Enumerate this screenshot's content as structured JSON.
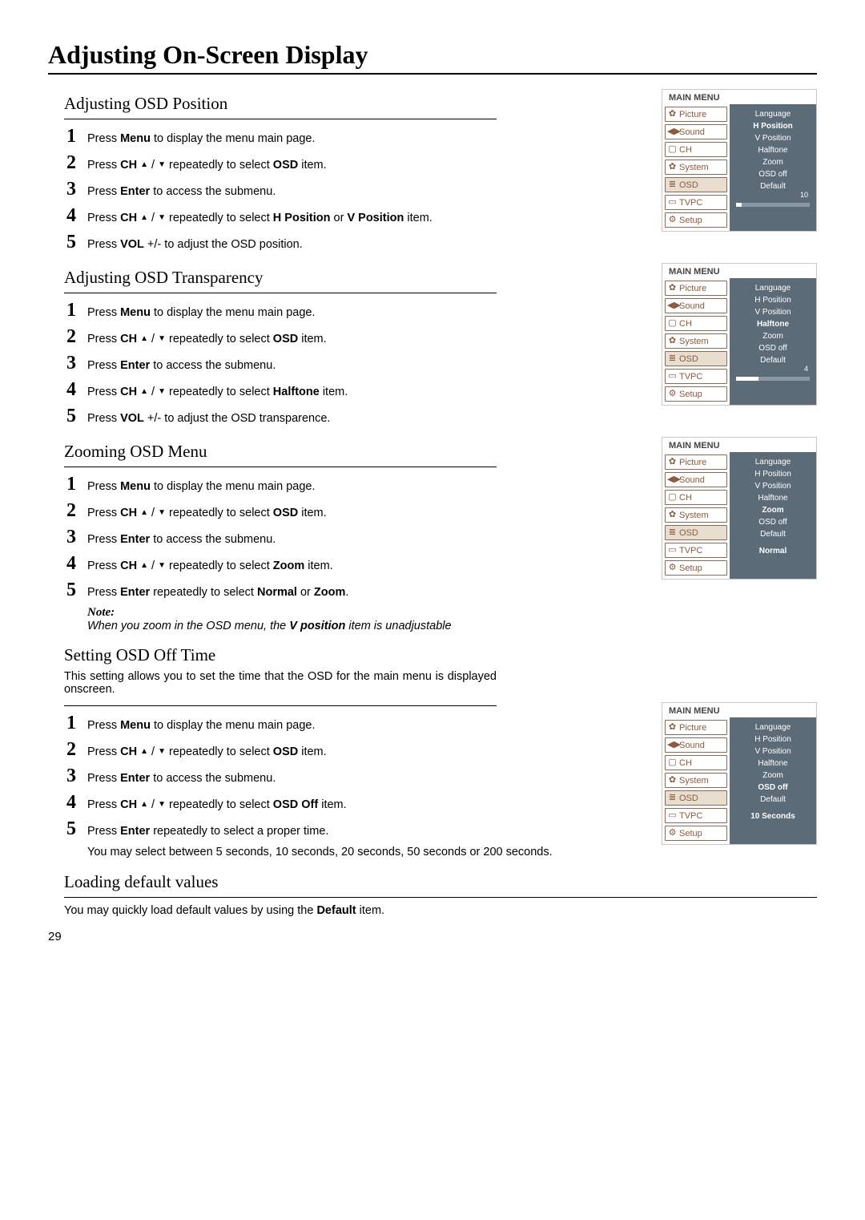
{
  "page": {
    "title": "Adjusting On-Screen Display",
    "number": "29"
  },
  "sections": {
    "position": {
      "title": "Adjusting OSD Position",
      "steps": [
        "Press <b>Menu</b> to display the menu main page.",
        "Press <b>CH</b> <span class='tri-up'>▲</span> / <span class='tri-down'>▼</span> repeatedly to select <b>OSD</b> item.",
        "Press <b>Enter</b> to access the submenu.",
        "Press <b>CH</b> <span class='tri-up'>▲</span> / <span class='tri-down'>▼</span> repeatedly to select <b>H Position</b> or <b>V Position</b> item.",
        "Press  <b>VOL</b> +/- to adjust the OSD position."
      ]
    },
    "transparency": {
      "title": "Adjusting OSD Transparency",
      "steps": [
        "Press <b>Menu</b> to display the menu main page.",
        "Press <b>CH</b> <span class='tri-up'>▲</span> / <span class='tri-down'>▼</span> repeatedly to select <b>OSD</b> item.",
        "Press <b>Enter</b> to access the submenu.",
        "Press <b>CH</b> <span class='tri-up'>▲</span> / <span class='tri-down'>▼</span> repeatedly to select <b>Halftone</b> item.",
        "Press  <b>VOL</b> +/- to adjust the OSD transparence."
      ]
    },
    "zoom": {
      "title": "Zooming OSD Menu",
      "steps": [
        "Press <b>Menu</b> to display the menu main page.",
        "Press <b>CH</b> <span class='tri-up'>▲</span> / <span class='tri-down'>▼</span> repeatedly to select <b>OSD</b> item.",
        "Press <b>Enter</b> to access the submenu.",
        "Press <b>CH</b> <span class='tri-up'>▲</span> / <span class='tri-down'>▼</span> repeatedly to select <b>Zoom</b> item.",
        "Press <b>Enter</b> repeatedly to select <b>Normal</b> or <b>Zoom</b>."
      ],
      "note_label": "Note:",
      "note_text": "When you zoom in the OSD menu, the <b><i>V position</i></b> item is unadjustable"
    },
    "offtime": {
      "title": "Setting OSD  Off Time",
      "desc": "This setting allows you to set the time that the OSD for the main menu is displayed onscreen.",
      "steps": [
        "Press <b>Menu</b> to display the menu main page.",
        "Press <b>CH</b> <span class='tri-up'>▲</span> / <span class='tri-down'>▼</span> repeatedly to select <b>OSD</b> item.",
        "Press <b>Enter</b> to access the submenu.",
        "Press <b>CH</b> <span class='tri-up'>▲</span> / <span class='tri-down'>▼</span> repeatedly to select <b>OSD Off</b> item.",
        "Press <b>Enter</b> repeatedly to select a proper time."
      ],
      "sub": "You may select between 5 seconds, 10 seconds, 20 seconds, 50 seconds or 200 seconds."
    },
    "default": {
      "title": "Loading default values",
      "desc": "You may quickly load default values  by using the <b>Default</b> item."
    }
  },
  "osd": {
    "title": "MAIN MENU",
    "left_items": [
      {
        "label": "Picture",
        "icon": "✿"
      },
      {
        "label": "Sound",
        "icon": "◀▶"
      },
      {
        "label": "CH",
        "icon": "▢"
      },
      {
        "label": "System",
        "icon": "✿"
      },
      {
        "label": "OSD",
        "icon": "≣"
      },
      {
        "label": "TVPC",
        "icon": "▭"
      },
      {
        "label": "Setup",
        "icon": "⚙"
      }
    ],
    "sub_items": [
      "Language",
      "H Position",
      "V Position",
      "Halftone",
      "Zoom",
      "OSD off",
      "Default"
    ],
    "panel1": {
      "selected_sub": "H Position",
      "value": "10",
      "progress_pct": 8
    },
    "panel2": {
      "selected_sub": "Halftone",
      "value": "4",
      "progress_pct": 30
    },
    "panel3": {
      "selected_sub": "Zoom",
      "value": "Normal"
    },
    "panel4": {
      "selected_sub": "OSD off",
      "value": "10 Seconds"
    }
  }
}
